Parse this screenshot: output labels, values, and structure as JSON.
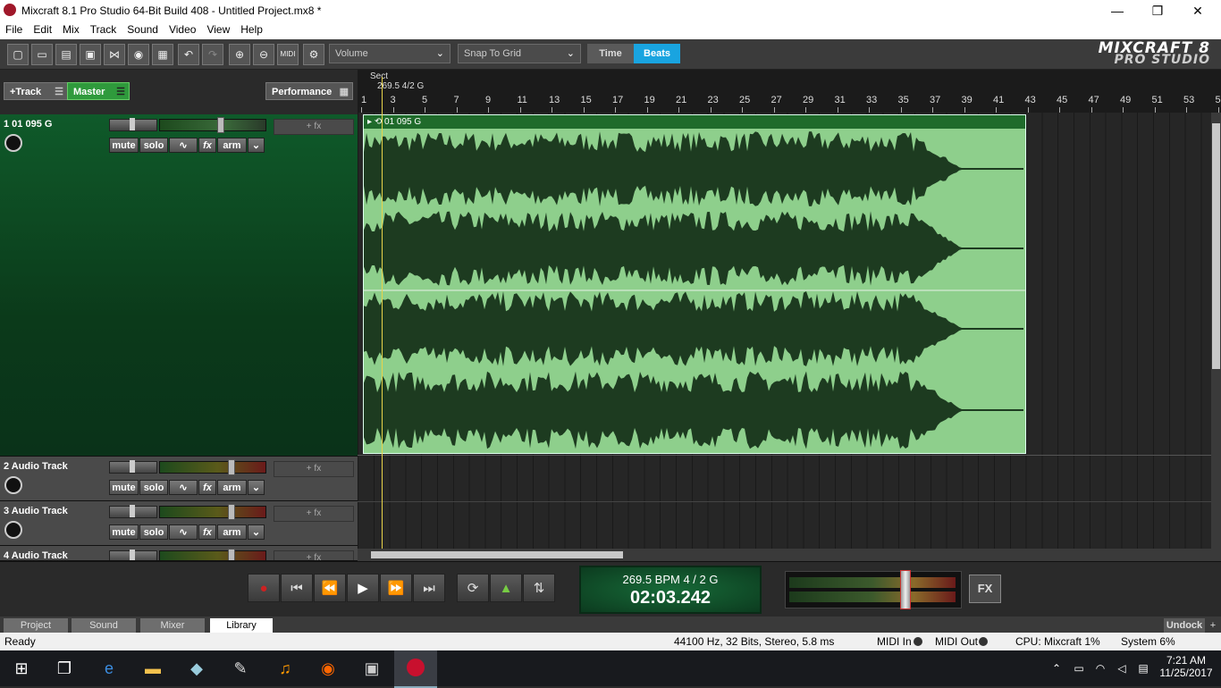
{
  "window": {
    "title": "Mixcraft 8.1 Pro Studio 64-Bit Build 408 - Untitled Project.mx8 *",
    "minimize": "—",
    "maximize": "❐",
    "close": "✕"
  },
  "menu": [
    "File",
    "Edit",
    "Mix",
    "Track",
    "Sound",
    "Video",
    "View",
    "Help"
  ],
  "toolbar": {
    "icons": [
      "new-icon",
      "open-icon",
      "open-recent-icon",
      "save-icon",
      "share-icon",
      "burn-cd-icon",
      "render-icon",
      "undo-icon",
      "redo-icon",
      "zoom-in-icon",
      "zoom-out-icon",
      "midi-icon",
      "settings-icon"
    ],
    "view_mode": "Volume",
    "snap_mode": "Snap To Grid",
    "time_label": "Time",
    "beats_label": "Beats",
    "logo_line1": "MIXCRAFT 8",
    "logo_line2": "PRO STUDIO"
  },
  "left_panel": {
    "add_track": "+Track",
    "master": "Master",
    "performance": "Performance"
  },
  "tracks": [
    {
      "name": "1 01 095 G",
      "mute": "mute",
      "solo": "solo",
      "fx": "fx",
      "arm": "arm",
      "fx_slot": "+ fx"
    },
    {
      "name": "2 Audio Track",
      "mute": "mute",
      "solo": "solo",
      "fx": "fx",
      "arm": "arm",
      "fx_slot": "+ fx"
    },
    {
      "name": "3 Audio Track",
      "mute": "mute",
      "solo": "solo",
      "fx": "fx",
      "arm": "arm",
      "fx_slot": "+ fx"
    },
    {
      "name": "4 Audio Track",
      "fx_slot": "+ fx"
    }
  ],
  "timeline": {
    "marker_label": "Sect",
    "tempo_marker": "269.5 4/2 G",
    "bars": [
      "1",
      "3",
      "5",
      "7",
      "9",
      "11",
      "13",
      "15",
      "17",
      "19",
      "21",
      "23",
      "25",
      "27",
      "29",
      "31",
      "33",
      "35",
      "37",
      "39",
      "41",
      "43",
      "45",
      "47",
      "49",
      "51",
      "53",
      "5"
    ],
    "clip_name": "01 095 G"
  },
  "transport": {
    "bpm_line": "269.5 BPM   4 / 2    G",
    "time": "02:03.242",
    "fx_button": "FX"
  },
  "tabs": [
    "Project",
    "Sound",
    "Mixer",
    "Library"
  ],
  "active_tab": "Library",
  "undock": "Undock",
  "status": {
    "ready": "Ready",
    "audio_format": "44100 Hz, 32 Bits, Stereo, 5.8 ms",
    "midi_in": "MIDI In",
    "midi_out": "MIDI Out",
    "cpu": "CPU: Mixcraft 1%",
    "system": "System 6%"
  },
  "taskbar": {
    "time": "7:21 AM",
    "date": "11/25/2017"
  }
}
